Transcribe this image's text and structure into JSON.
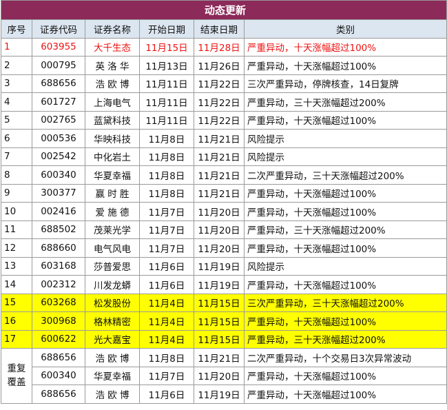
{
  "title": "动态更新",
  "headers": [
    "序号",
    "证券代码",
    "证券名称",
    "开始日期",
    "结束日期",
    "类别"
  ],
  "rows": [
    {
      "no": "1",
      "code": "603955",
      "name": "大千生态",
      "start": "11月15日",
      "end": "11月28日",
      "category": "严重异动，十天涨幅超过100%"
    },
    {
      "no": "2",
      "code": "000795",
      "name": "英 洛 华",
      "start": "11月13日",
      "end": "11月26日",
      "category": "严重异动，十天涨幅超过100%"
    },
    {
      "no": "3",
      "code": "688656",
      "name": "浩 欧 博",
      "start": "11月11日",
      "end": "11月22日",
      "category": "三次严重异动，停牌核查，14日复牌"
    },
    {
      "no": "4",
      "code": "601727",
      "name": "上海电气",
      "start": "11月11日",
      "end": "11月22日",
      "category": "严重异动，三十天涨幅超过200%"
    },
    {
      "no": "5",
      "code": "002765",
      "name": "蓝黛科技",
      "start": "11月11日",
      "end": "11月22日",
      "category": "严重异动，十天涨幅超过100%"
    },
    {
      "no": "6",
      "code": "000536",
      "name": "华映科技",
      "start": "11月8日",
      "end": "11月21日",
      "category": "风险提示"
    },
    {
      "no": "7",
      "code": "002542",
      "name": "中化岩土",
      "start": "11月8日",
      "end": "11月21日",
      "category": "风险提示"
    },
    {
      "no": "8",
      "code": "600340",
      "name": "华夏幸福",
      "start": "11月8日",
      "end": "11月21日",
      "category": "二次严重异动，三十天涨幅超过200%"
    },
    {
      "no": "9",
      "code": "300377",
      "name": "赢 时 胜",
      "start": "11月8日",
      "end": "11月21日",
      "category": "严重异动，十天涨幅超过100%"
    },
    {
      "no": "10",
      "code": "002416",
      "name": "爱 施 德",
      "start": "11月7日",
      "end": "11月20日",
      "category": "严重异动，十天涨幅超过100%"
    },
    {
      "no": "11",
      "code": "688502",
      "name": "茂莱光学",
      "start": "11月7日",
      "end": "11月20日",
      "category": "严重异动，三十天涨幅超过200%"
    },
    {
      "no": "12",
      "code": "688660",
      "name": "电气风电",
      "start": "11月7日",
      "end": "11月20日",
      "category": "严重异动，十天涨幅超过100%"
    },
    {
      "no": "13",
      "code": "603168",
      "name": "莎普爱思",
      "start": "11月6日",
      "end": "11月19日",
      "category": "风险提示"
    },
    {
      "no": "14",
      "code": "002312",
      "name": "川发龙蟒",
      "start": "11月6日",
      "end": "11月19日",
      "category": "严重异动，十天涨幅超过100%"
    },
    {
      "no": "15",
      "code": "603268",
      "name": "松发股份",
      "start": "11月4日",
      "end": "11月15日",
      "category": "三次严重异动，三十天涨幅超过200%"
    },
    {
      "no": "16",
      "code": "300968",
      "name": "格林精密",
      "start": "11月4日",
      "end": "11月15日",
      "category": "严重异动，十天涨幅超过100%"
    },
    {
      "no": "17",
      "code": "600622",
      "name": "光大嘉宝",
      "start": "11月4日",
      "end": "11月15日",
      "category": "严重异动，三十天涨幅超过200%"
    }
  ],
  "overlap_label_line1": "重复",
  "overlap_label_line2": "覆盖",
  "overlap_rows": [
    {
      "code": "688656",
      "name": "浩 欧 博",
      "start": "11月8日",
      "end": "11月21日",
      "category": "二次严重异动，十个交易日3次异常波动"
    },
    {
      "code": "600340",
      "name": "华夏幸福",
      "start": "11月7日",
      "end": "11月20日",
      "category": "严重异动，十天涨幅超过100%"
    },
    {
      "code": "688656",
      "name": "浩 欧 博",
      "start": "11月6日",
      "end": "11月19日",
      "category": "严重异动，十天涨幅超过100%"
    }
  ],
  "colors": {
    "title_bg": "#8c2a5a",
    "header_bg": "#dce6f1",
    "highlight_text": "#ee1111",
    "highlight_row": "#ffff00"
  }
}
